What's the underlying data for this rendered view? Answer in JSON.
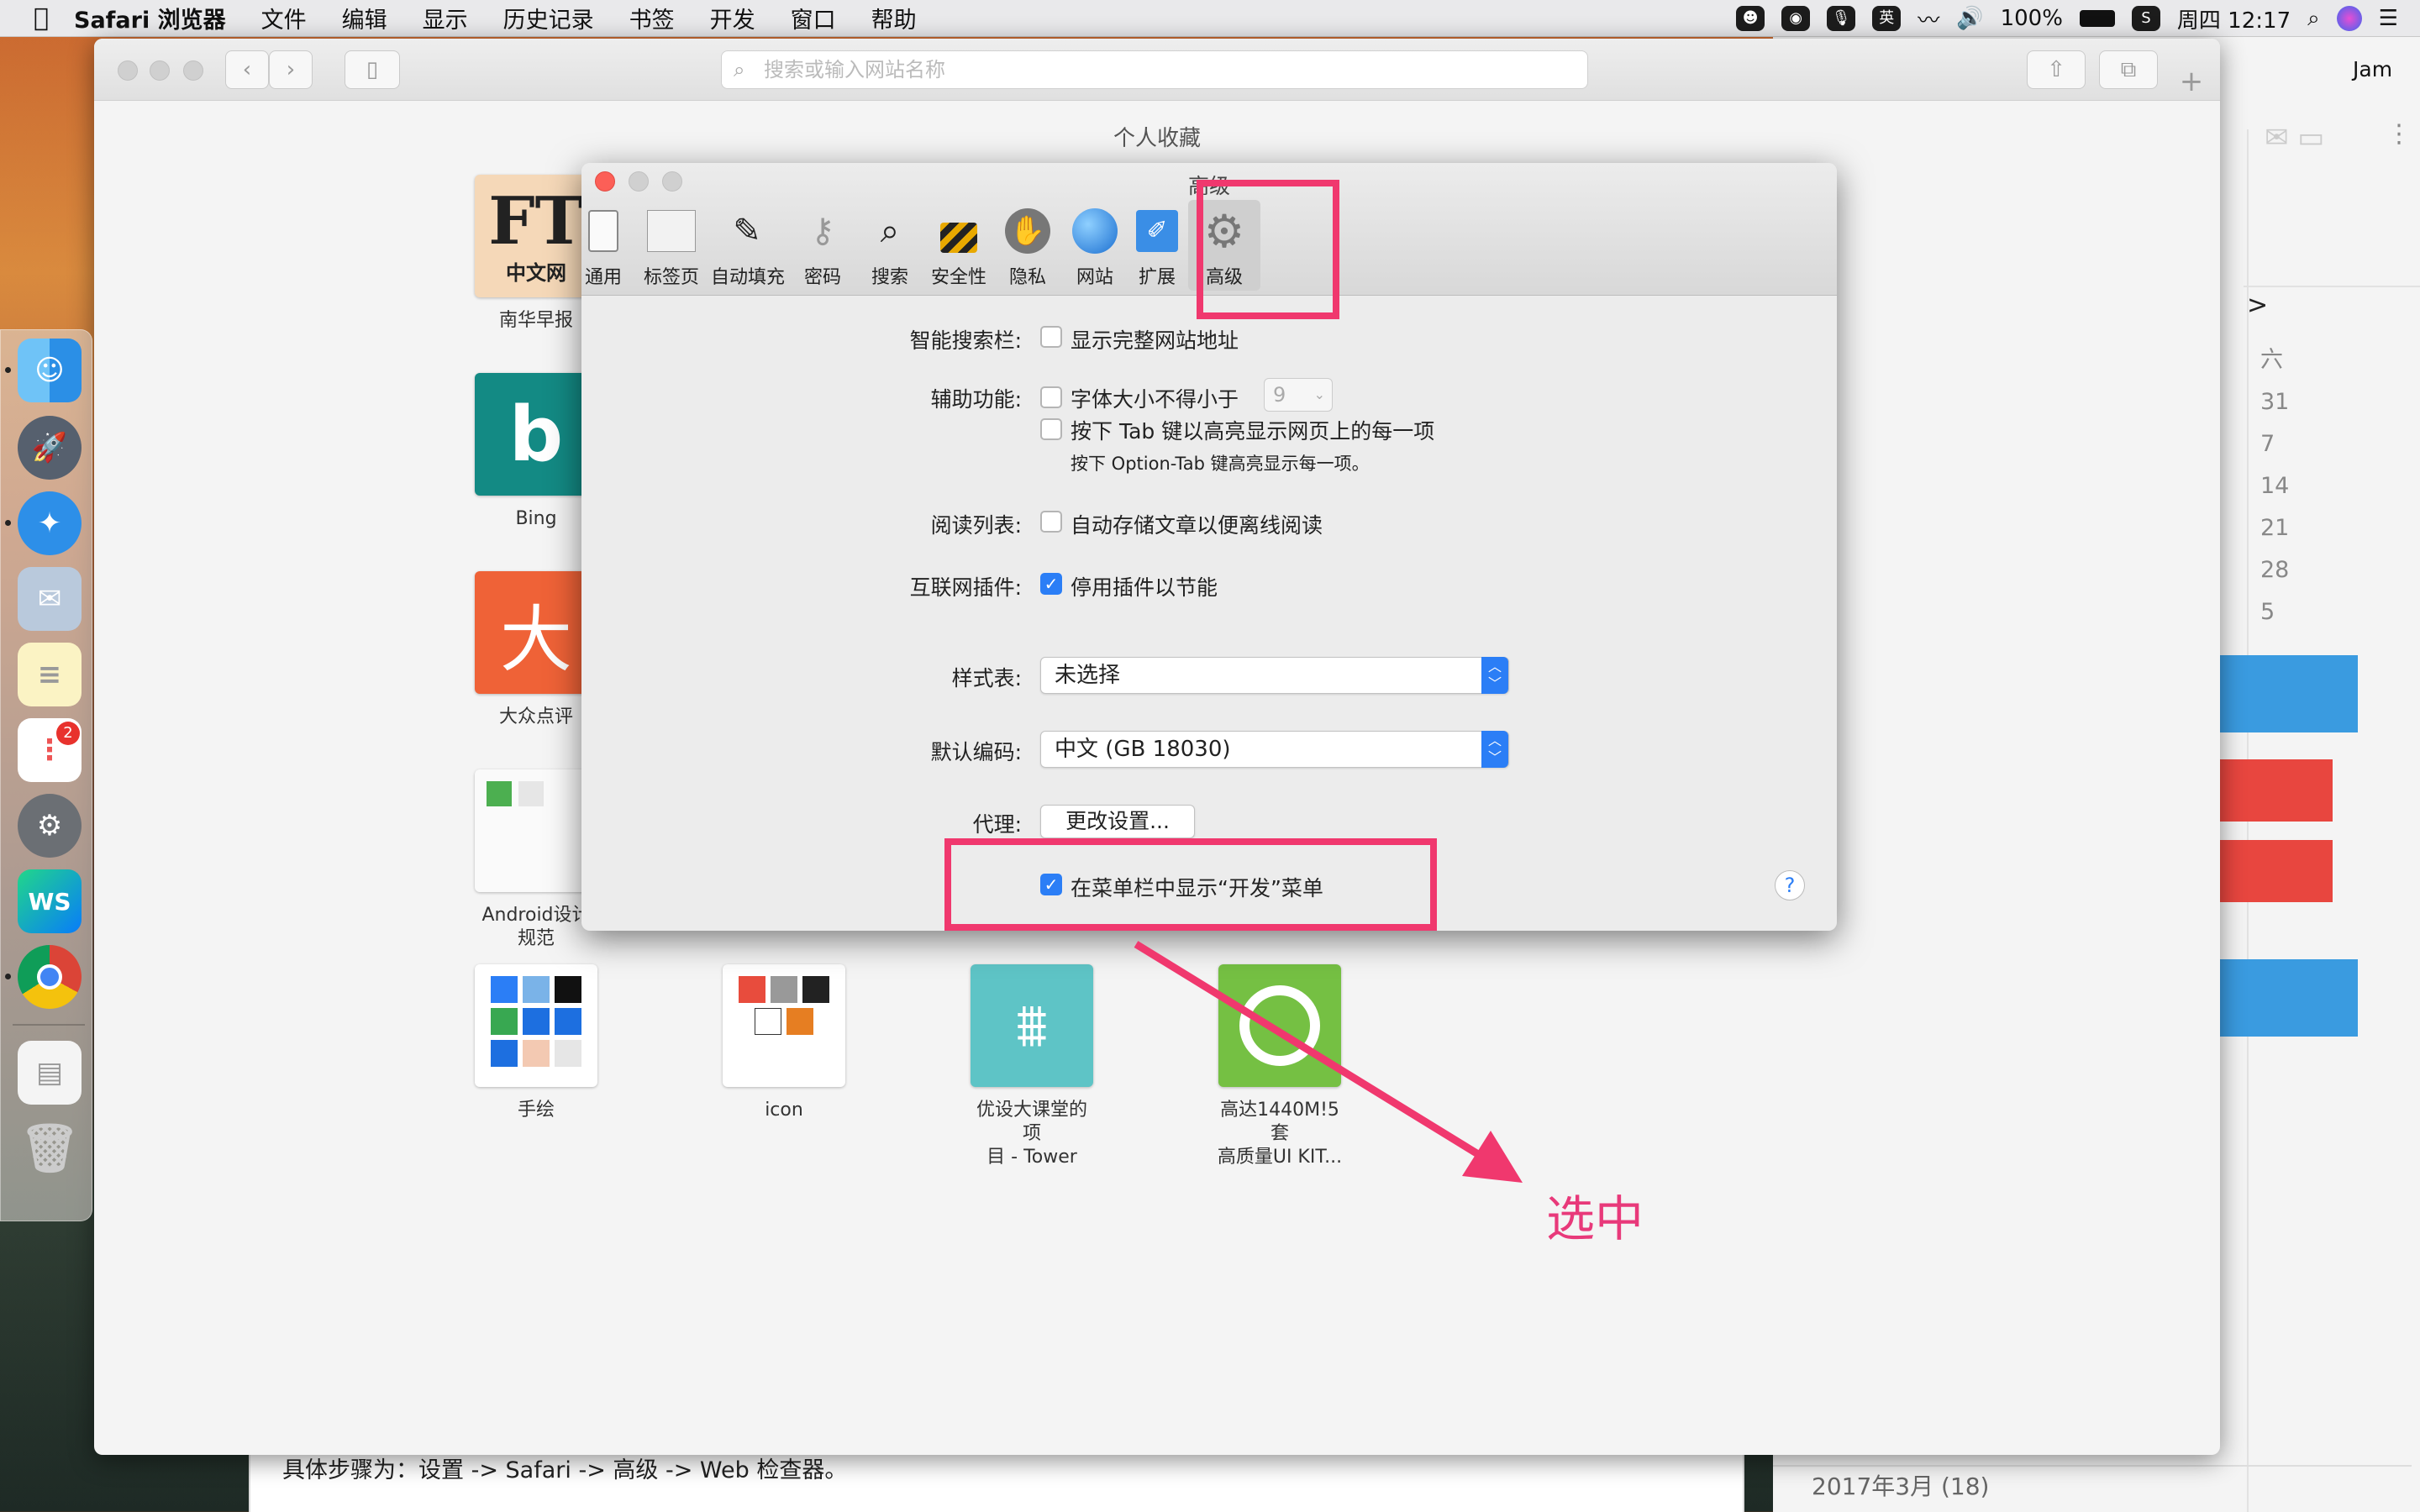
{
  "menubar": {
    "app": "Safari 浏览器",
    "items": [
      "文件",
      "编辑",
      "显示",
      "历史记录",
      "书签",
      "开发",
      "窗口",
      "帮助"
    ],
    "status": {
      "ime": "英",
      "battery": "100%",
      "clock": "周四 12:17"
    }
  },
  "safari": {
    "search_placeholder": "搜索或输入网站名称",
    "favorites_title": "个人收藏",
    "user": "Jam",
    "tiles": [
      {
        "label": "南华早报"
      },
      {
        "label": "Bing"
      },
      {
        "label": "大众点评"
      },
      {
        "label": "Android设计\n规范"
      },
      {
        "label": "手绘"
      },
      {
        "label": "icon"
      },
      {
        "label": "优设大课堂的项\n目 - Tower"
      },
      {
        "label": "高达1440M!5套\n高质量UI KIT..."
      }
    ],
    "tile_glyphs": {
      "ft": "FT",
      "ft_sub": "中文网",
      "dianping": "大"
    }
  },
  "prefs": {
    "title": "高级",
    "tabs": [
      "通用",
      "标签页",
      "自动填充",
      "密码",
      "搜索",
      "安全性",
      "隐私",
      "网站",
      "扩展",
      "高级"
    ],
    "rows": {
      "smart_search": {
        "label": "智能搜索栏:",
        "option": "显示完整网站地址",
        "checked": false
      },
      "accessibility": {
        "label": "辅助功能:",
        "font_option": "字体大小不得小于",
        "font_size": "9",
        "tab_option": "按下 Tab 键以高亮显示网页上的每一项",
        "hint": "按下 Option-Tab 键高亮显示每一项。"
      },
      "reading_list": {
        "label": "阅读列表:",
        "option": "自动存储文章以便离线阅读",
        "checked": false
      },
      "plugins": {
        "label": "互联网插件:",
        "option": "停用插件以节能",
        "checked": true
      },
      "stylesheet": {
        "label": "样式表:",
        "value": "未选择"
      },
      "encoding": {
        "label": "默认编码:",
        "value": "中文 (GB 18030)"
      },
      "proxy": {
        "label": "代理:",
        "button": "更改设置..."
      },
      "develop": {
        "option": "在菜单栏中显示“开发”菜单",
        "checked": true
      }
    },
    "help": "?"
  },
  "annotation": {
    "note": "选中",
    "accent": "#f0386e"
  },
  "background": {
    "calendar_col": [
      "六",
      "31",
      "7",
      "14",
      "21",
      "28",
      "5"
    ],
    "nav": ">",
    "bottom_text": "具体步骤为：设置 -> Safari -> 高级 -> Web 检查器。",
    "archive": "2017年3月 (18)"
  }
}
